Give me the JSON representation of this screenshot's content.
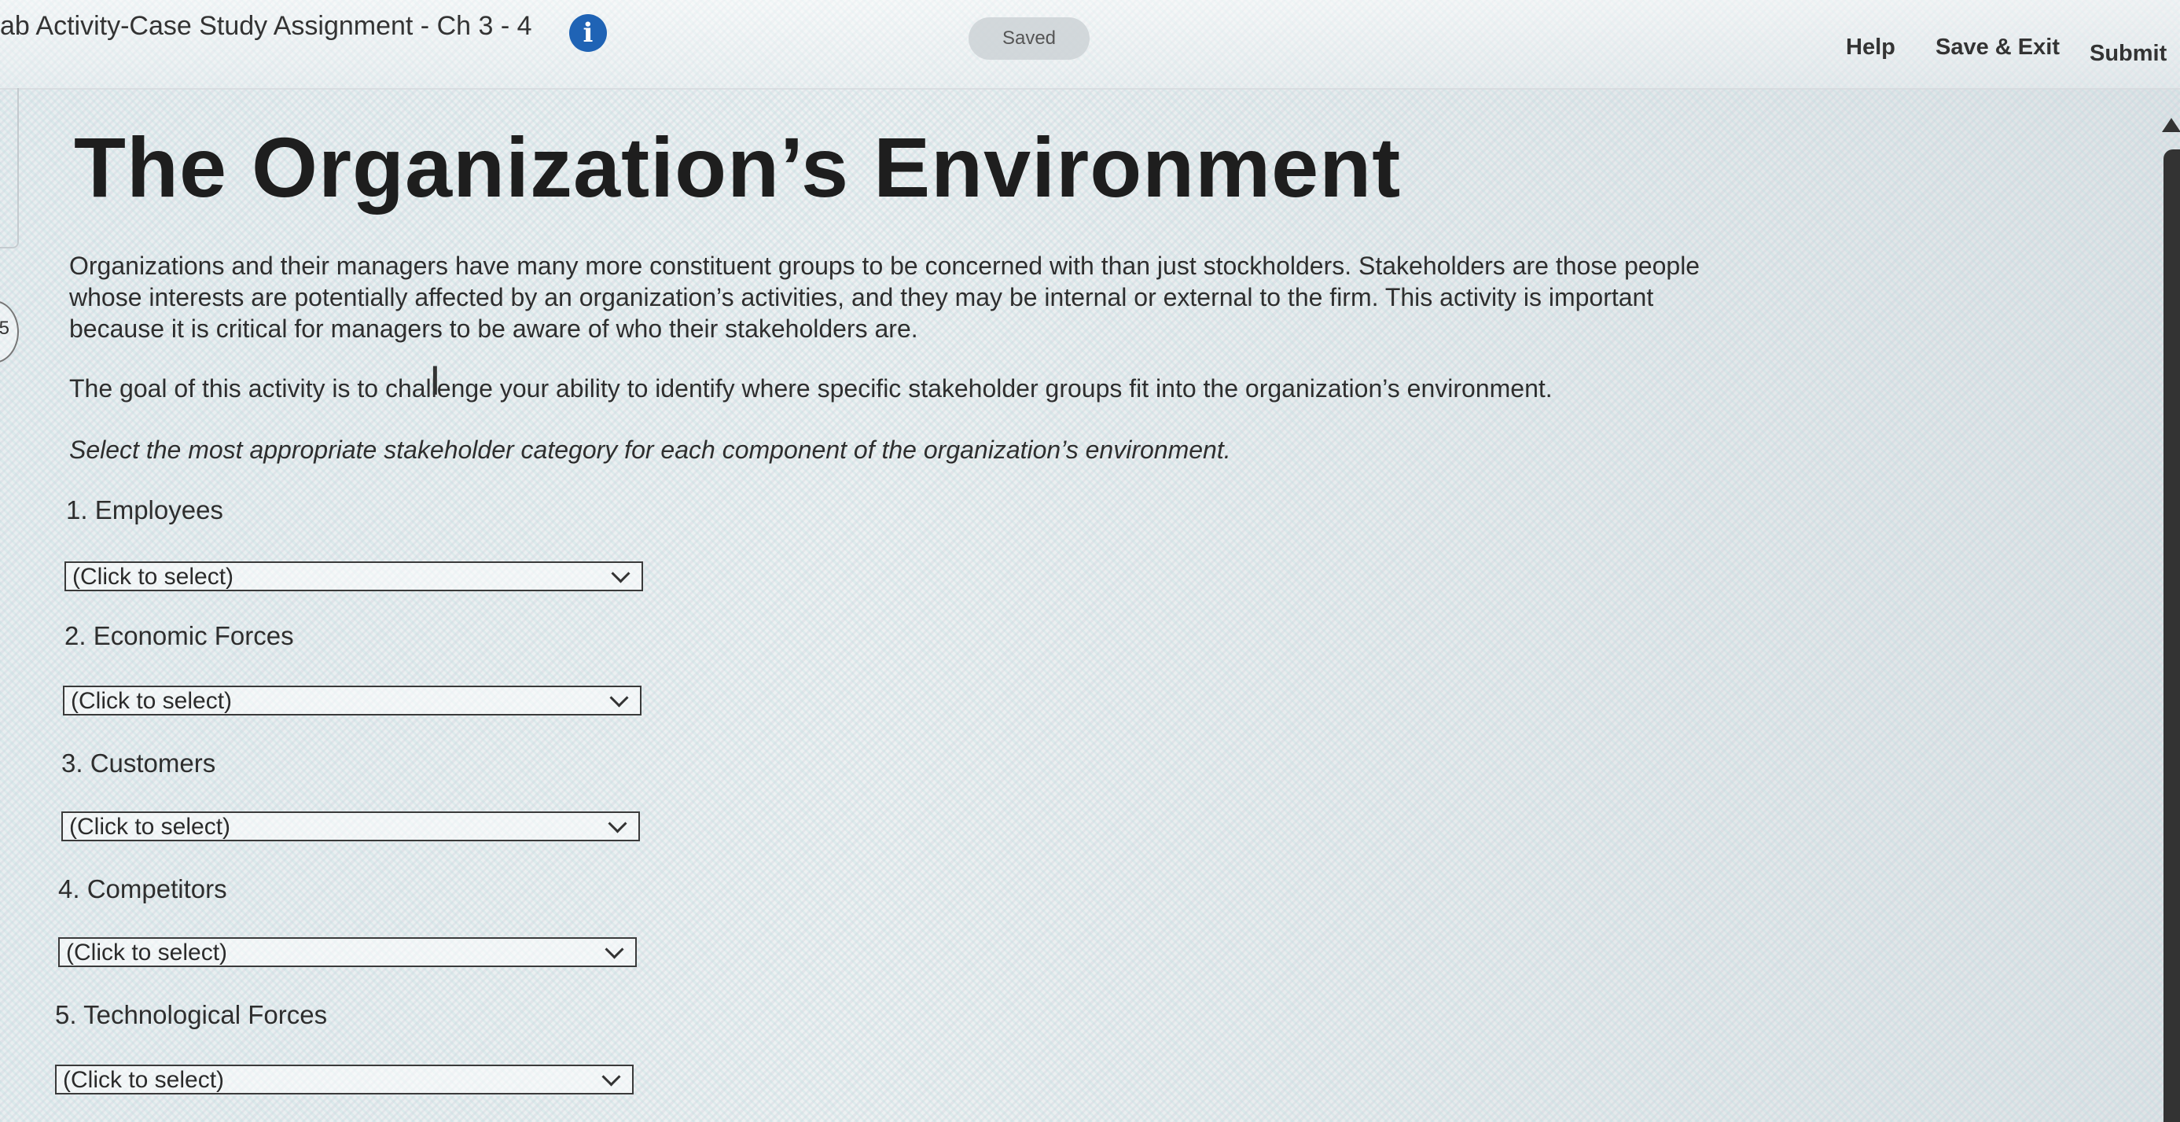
{
  "header": {
    "assignment_title": "ab Activity-Case Study Assignment - Ch 3 - 4",
    "info_glyph": "i",
    "saved_status": "Saved",
    "help_label": "Help",
    "save_exit_label": "Save & Exit",
    "submit_label": "Submit"
  },
  "side": {
    "circle_label": "5"
  },
  "content": {
    "title": "The Organization’s Environment",
    "intro": "Organizations and their managers have many more constituent groups to be concerned with than just stockholders. Stakeholders are those people whose interests are potentially affected by an organization’s activities, and they may be internal or external to the firm. This activity is important because it is critical for managers to be aware of who their stakeholders are.",
    "goal": "The goal of this activity is to challenge your ability to identify where specific stakeholder groups fit into the organization’s environment.",
    "instruction": "Select the most appropriate stakeholder category for each component of the organization’s environment.",
    "text_cursor_glyph": "I"
  },
  "questions": [
    {
      "label": "1. Employees",
      "selected": "(Click to select)"
    },
    {
      "label": "2. Economic Forces",
      "selected": "(Click to select)"
    },
    {
      "label": "3. Customers",
      "selected": "(Click to select)"
    },
    {
      "label": "4. Competitors",
      "selected": "(Click to select)"
    },
    {
      "label": "5. Technological Forces",
      "selected": "(Click to select)"
    }
  ],
  "colors": {
    "info_icon": "#1f63b5",
    "title_text": "#1e1e1e"
  }
}
